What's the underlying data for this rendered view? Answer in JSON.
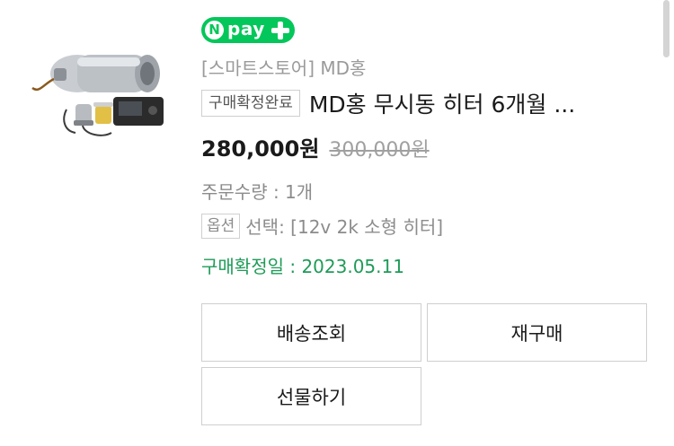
{
  "payment": {
    "brand_label": "pay",
    "brand_initial": "N"
  },
  "order": {
    "store": "[스마트스토어] MD홍",
    "status_badge": "구매확정완료",
    "title": "MD홍 무시동 히터 6개월 ...",
    "price": "280,000원",
    "original_price": "300,000원",
    "quantity": "주문수량 : 1개",
    "option_badge": "옵션",
    "option_text": "선택: [12v 2k 소형 히터]",
    "confirm_date": "구매확정일 : 2023.05.11"
  },
  "buttons": {
    "track": "배송조회",
    "rebuy": "재구매",
    "gift": "선물하기"
  },
  "colors": {
    "npay_green": "#03c75a",
    "confirm_green": "#1f9b58"
  }
}
